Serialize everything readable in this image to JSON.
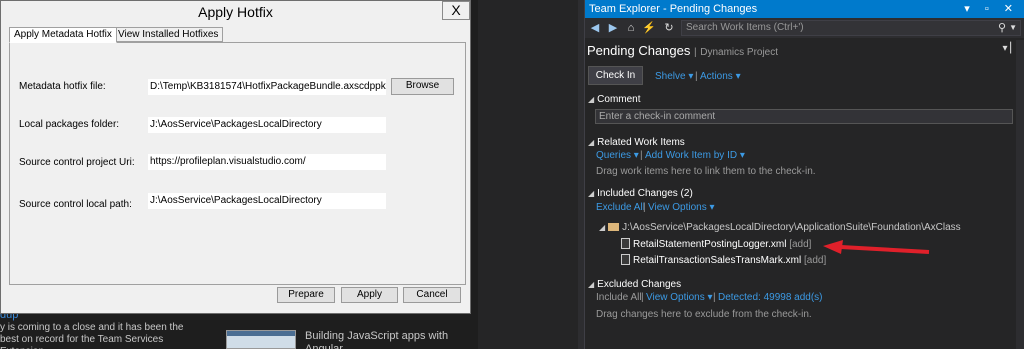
{
  "background": {
    "news_title": "dup",
    "news_text": "y is coming to a close and it has been the best on record for the Team Services Extension",
    "news_right": "Building JavaScript apps with Angular"
  },
  "dialog": {
    "title": "Apply Hotfix",
    "close_glyph": "X",
    "tabs": [
      "Apply Metadata Hotfix",
      "View Installed Hotfixes"
    ],
    "fields": [
      {
        "label": "Metadata hotfix file:",
        "value": "D:\\Temp\\KB3181574\\HotfixPackageBundle.axscdppkg"
      },
      {
        "label": "Local packages folder:",
        "value": "J:\\AosService\\PackagesLocalDirectory"
      },
      {
        "label": "Source control project Uri:",
        "value": "https://profileplan.visualstudio.com/"
      },
      {
        "label": "Source control local path:",
        "value": "J:\\AosService\\PackagesLocalDirectory"
      }
    ],
    "browse_label": "Browse",
    "prepare_label": "Prepare",
    "apply_label": "Apply",
    "cancel_label": "Cancel"
  },
  "team_explorer": {
    "title": "Team Explorer - Pending Changes",
    "title_icons": "▾ ▫ ✕",
    "search_placeholder": "Search Work Items (Ctrl+')",
    "header": "Pending Changes",
    "header_sep": "|",
    "header_sub": "Dynamics Project",
    "checkin_label": "Check In",
    "shelve_label": "Shelve ▾",
    "pipe": "|",
    "actions_label": "Actions ▾",
    "comment": {
      "title": "Comment",
      "placeholder": "Enter a check-in comment"
    },
    "related": {
      "title": "Related Work Items",
      "queries_label": "Queries ▾",
      "add_label": "Add Work Item by ID ▾",
      "hint": "Drag work items here to link them to the check-in."
    },
    "included": {
      "title": "Included Changes (2)",
      "exclude_all": "Exclude All",
      "view_options": "View Options ▾",
      "folder": "J:\\AosService\\PackagesLocalDirectory\\ApplicationSuite\\Foundation\\AxClass",
      "files": [
        {
          "name": "RetailStatementPostingLogger.xml",
          "tag": "[add]"
        },
        {
          "name": "RetailTransactionSalesTransMark.xml",
          "tag": "[add]"
        }
      ]
    },
    "excluded": {
      "title": "Excluded Changes",
      "include_all": "Include All",
      "view_options": "View Options ▾",
      "detected": "Detected: 49998 add(s)",
      "hint": "Drag changes here to exclude from the check-in."
    }
  },
  "colors": {
    "accent": "#007acc",
    "link": "#3c9ae4",
    "arrow": "#e0202a"
  }
}
